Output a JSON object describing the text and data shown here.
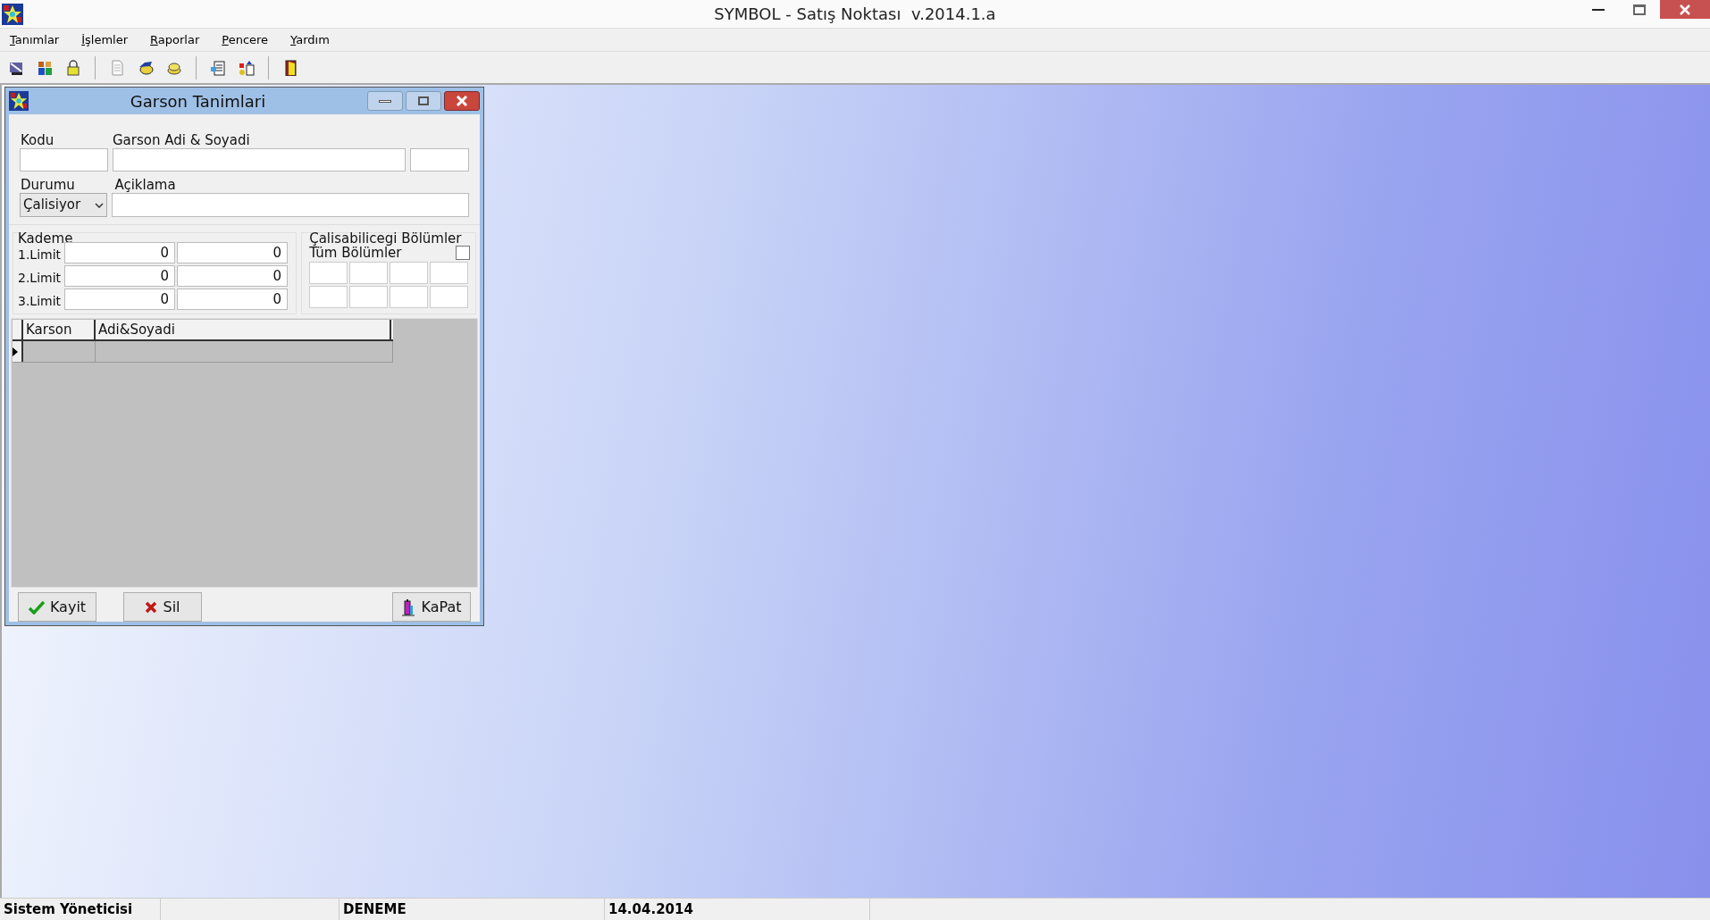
{
  "window": {
    "title": "SYMBOL - Satış Noktası  v.2014.1.a"
  },
  "menu": [
    "Tanımlar",
    "İşlemler",
    "Raporlar",
    "Pencere",
    "Yardım"
  ],
  "toolbar": [
    {
      "kind": "button"
    },
    {
      "kind": "button"
    },
    {
      "kind": "button"
    },
    {
      "kind": "separator"
    },
    {
      "kind": "button"
    },
    {
      "kind": "button"
    },
    {
      "kind": "button"
    },
    {
      "kind": "separator"
    },
    {
      "kind": "button"
    },
    {
      "kind": "button"
    },
    {
      "kind": "separator"
    },
    {
      "kind": "button"
    }
  ],
  "dialog": {
    "title": "Garson Tanimlari",
    "labels": {
      "code": "Kodu",
      "name": "Garson Adi & Soyadi",
      "status": "Durumu",
      "description": "Açiklama"
    },
    "status_value": "Çalisiyor",
    "levels": {
      "title": "Kademe",
      "rows": [
        {
          "label": "1.Limit",
          "values": [
            "0",
            "0"
          ]
        },
        {
          "label": "2.Limit",
          "values": [
            "0",
            "0"
          ]
        },
        {
          "label": "3.Limit",
          "values": [
            "0",
            "0"
          ]
        }
      ]
    },
    "sections": {
      "title": "Çalisabilicegi Bölümler",
      "all_label": "Tüm Bölümler",
      "all_checked": false
    },
    "table": {
      "columns": [
        "Karson",
        "Adi&Soyadi"
      ]
    },
    "buttons": [
      {
        "kind": "save",
        "label": "Kayit"
      },
      {
        "kind": "delete",
        "label": "Sil"
      },
      {
        "kind": "close",
        "label": "KaPat"
      }
    ]
  },
  "status_bar": [
    "Sistem Yöneticisi",
    "DENEME",
    "14.04.2014"
  ]
}
